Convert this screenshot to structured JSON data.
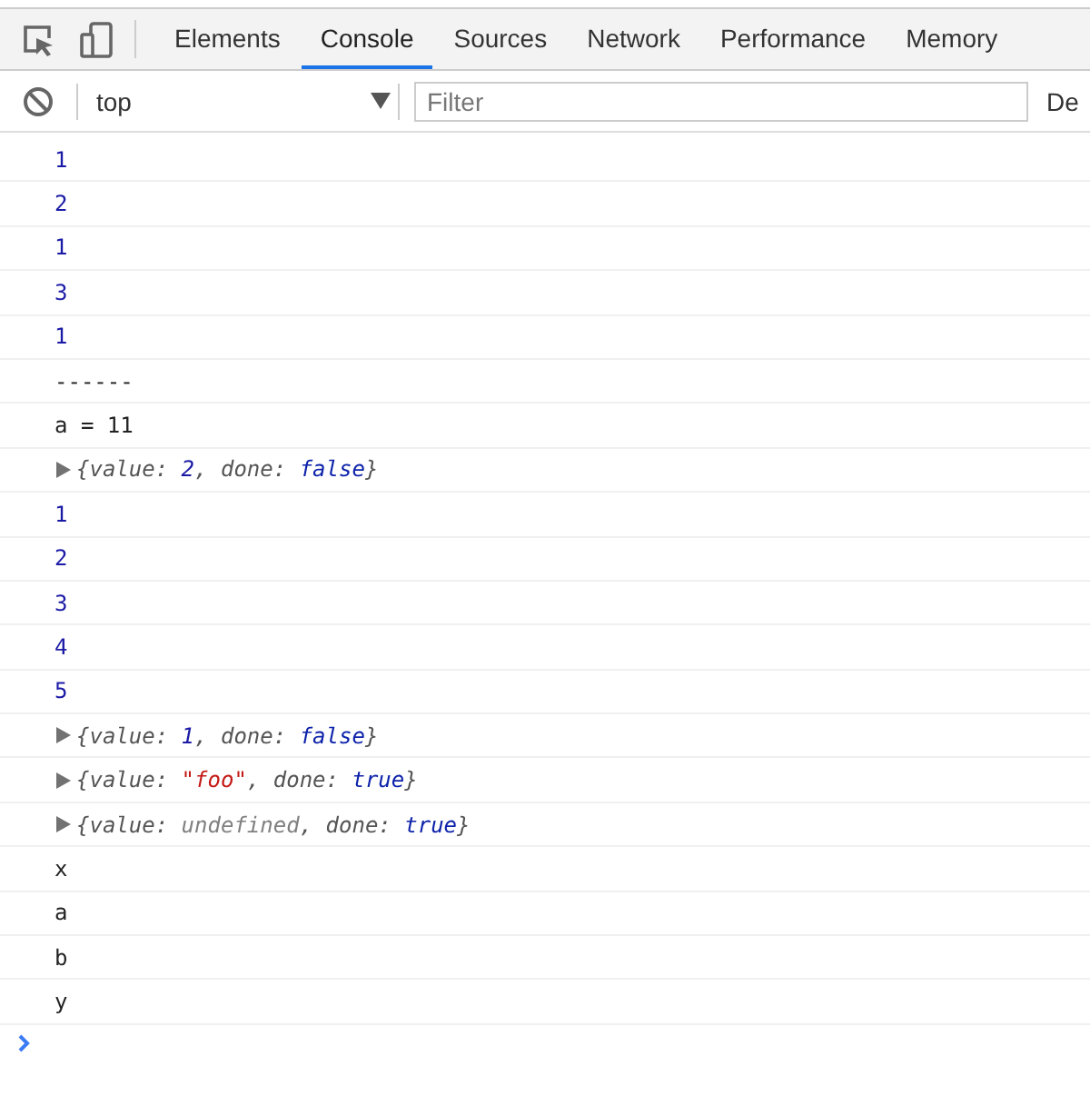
{
  "tabs": [
    {
      "label": "Elements",
      "selected": false
    },
    {
      "label": "Console",
      "selected": true
    },
    {
      "label": "Sources",
      "selected": false
    },
    {
      "label": "Network",
      "selected": false
    },
    {
      "label": "Performance",
      "selected": false
    },
    {
      "label": "Memory",
      "selected": false
    }
  ],
  "context_selector": {
    "value": "top"
  },
  "filter": {
    "placeholder": "Filter"
  },
  "levels_label": "De",
  "console_rows": [
    {
      "kind": "number",
      "text": "1"
    },
    {
      "kind": "number",
      "text": "2"
    },
    {
      "kind": "number",
      "text": "1"
    },
    {
      "kind": "number",
      "text": "3"
    },
    {
      "kind": "number",
      "text": "1"
    },
    {
      "kind": "text",
      "text": "------"
    },
    {
      "kind": "text",
      "text": "a = 11"
    },
    {
      "kind": "object",
      "tokens": [
        {
          "kind": "plain",
          "text": "{value: "
        },
        {
          "kind": "number",
          "text": "2"
        },
        {
          "kind": "plain",
          "text": ", done: "
        },
        {
          "kind": "keyword",
          "text": "false"
        },
        {
          "kind": "plain",
          "text": "}"
        }
      ]
    },
    {
      "kind": "number",
      "text": "1"
    },
    {
      "kind": "number",
      "text": "2"
    },
    {
      "kind": "number",
      "text": "3"
    },
    {
      "kind": "number",
      "text": "4"
    },
    {
      "kind": "number",
      "text": "5"
    },
    {
      "kind": "object",
      "tokens": [
        {
          "kind": "plain",
          "text": "{value: "
        },
        {
          "kind": "number",
          "text": "1"
        },
        {
          "kind": "plain",
          "text": ", done: "
        },
        {
          "kind": "keyword",
          "text": "false"
        },
        {
          "kind": "plain",
          "text": "}"
        }
      ]
    },
    {
      "kind": "object",
      "tokens": [
        {
          "kind": "plain",
          "text": "{value: "
        },
        {
          "kind": "string",
          "text": "\"foo\""
        },
        {
          "kind": "plain",
          "text": ", done: "
        },
        {
          "kind": "keyword",
          "text": "true"
        },
        {
          "kind": "plain",
          "text": "}"
        }
      ]
    },
    {
      "kind": "object",
      "tokens": [
        {
          "kind": "plain",
          "text": "{value: "
        },
        {
          "kind": "undefined",
          "text": "undefined"
        },
        {
          "kind": "plain",
          "text": ", done: "
        },
        {
          "kind": "keyword",
          "text": "true"
        },
        {
          "kind": "plain",
          "text": "}"
        }
      ]
    },
    {
      "kind": "text",
      "text": "x"
    },
    {
      "kind": "text",
      "text": "a"
    },
    {
      "kind": "text",
      "text": "b"
    },
    {
      "kind": "text",
      "text": "y"
    }
  ]
}
